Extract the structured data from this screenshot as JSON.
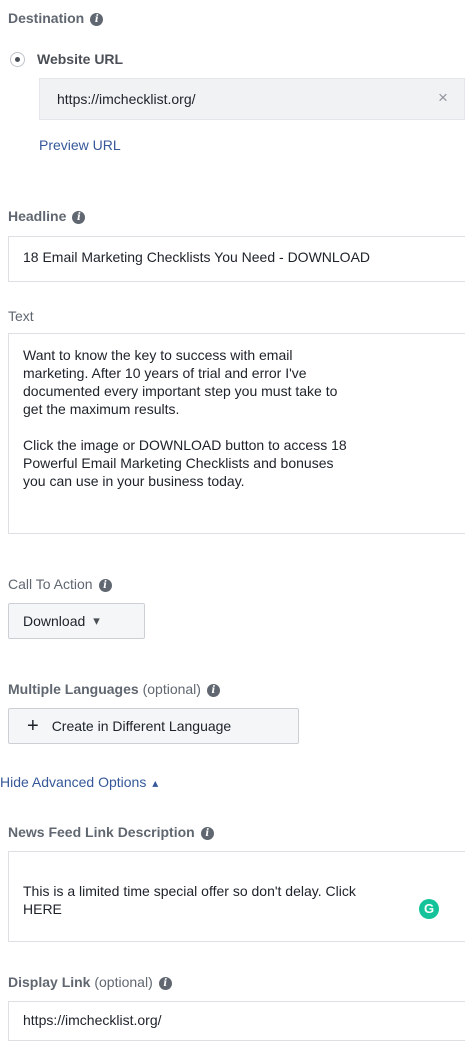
{
  "destination": {
    "label": "Destination",
    "option_label": "Website URL",
    "url_value": "https://imchecklist.org/",
    "clear_glyph": "×",
    "preview_link": "Preview URL"
  },
  "headline": {
    "label": "Headline",
    "value": "18 Email Marketing Checklists You Need - DOWNLOAD"
  },
  "text": {
    "label": "Text",
    "value": "Want to know the key to success with email\nmarketing. After 10 years of trial and error I've\ndocumented every important step you must take to\nget the maximum results.\n\nClick the image or DOWNLOAD button to access 18\nPowerful Email Marketing Checklists and bonuses\nyou can use in your business today."
  },
  "call_to_action": {
    "label": "Call To Action",
    "selected": "Download",
    "caret": "▾"
  },
  "languages": {
    "label": "Multiple Languages",
    "optional": "(optional)",
    "button_icon": "+",
    "button_label": "Create in Different Language"
  },
  "advanced": {
    "toggle_label": "Hide Advanced Options",
    "toggle_caret": "▴"
  },
  "news_feed": {
    "label": "News Feed Link Description",
    "value": "This is a limited time special offer so don't delay. Click\nHERE",
    "grammarly_glyph": "G"
  },
  "display_link": {
    "label": "Display Link",
    "optional": "(optional)",
    "value": "https://imchecklist.org/"
  },
  "icons": {
    "info": "i"
  },
  "colors": {
    "link": "#365899",
    "grammarly": "#15c39a",
    "label": "#606770"
  }
}
